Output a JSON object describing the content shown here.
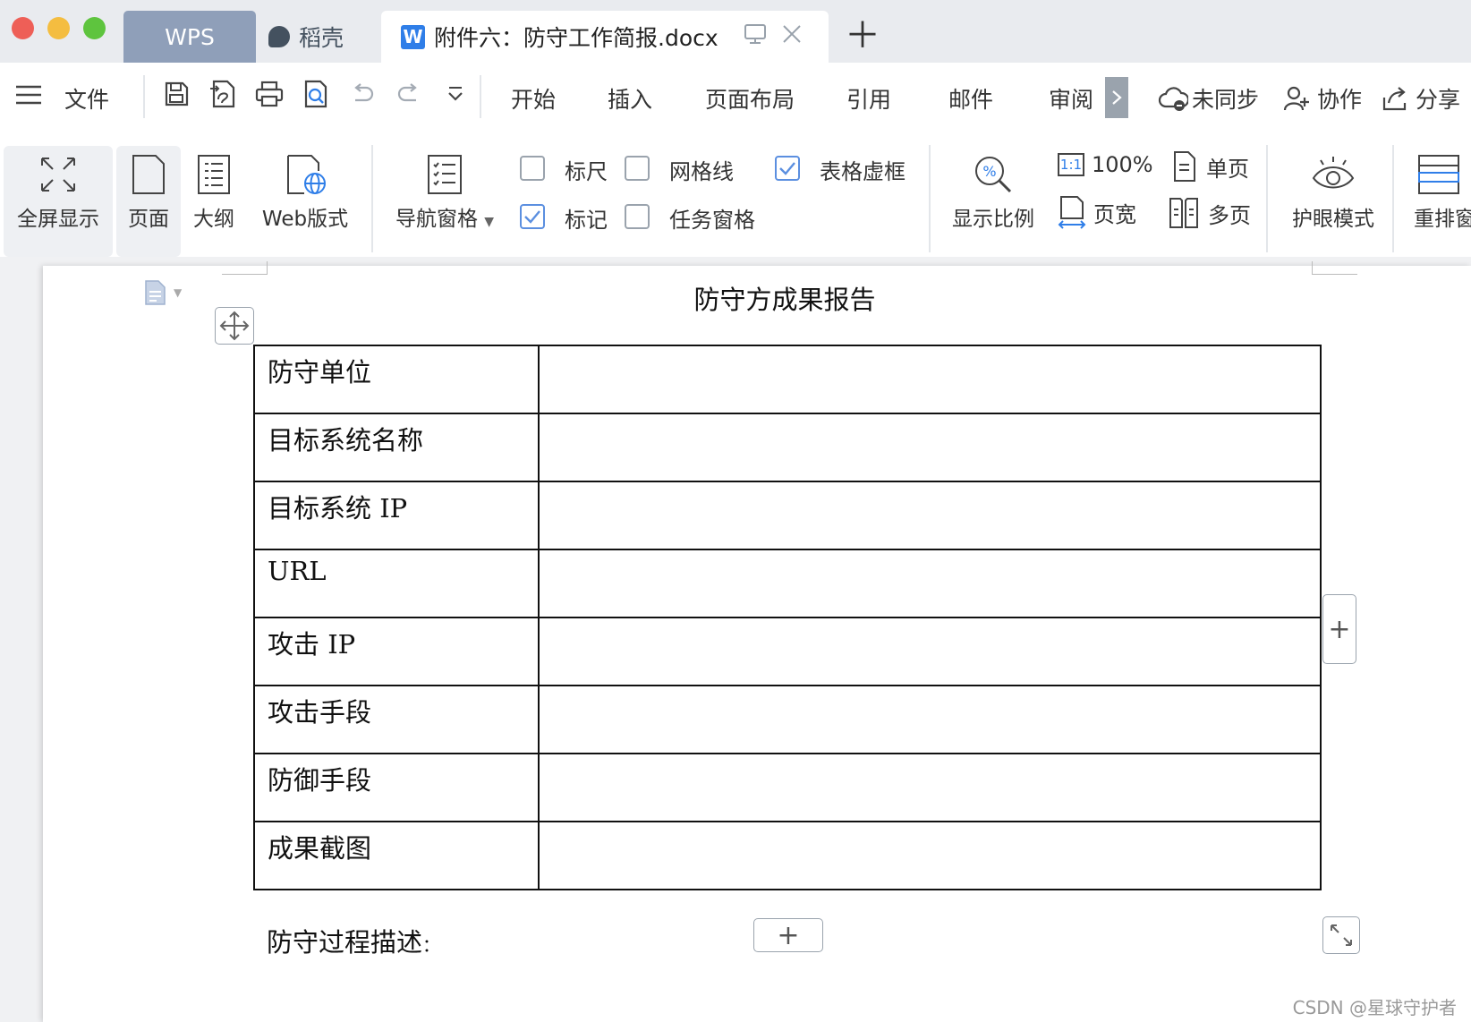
{
  "tabs": {
    "wps": "WPS",
    "daoke": "稻壳",
    "document": "附件六：防守工作简报.docx",
    "doc_badge": "W"
  },
  "menubar": {
    "file": "文件",
    "items": [
      "开始",
      "插入",
      "页面布局",
      "引用",
      "邮件",
      "审阅"
    ],
    "sync": "未同步",
    "collab": "协作",
    "share": "分享"
  },
  "ribbon": {
    "fullscreen": "全屏显示",
    "page": "页面",
    "outline": "大纲",
    "web": "Web版式",
    "nav_pane": "导航窗格",
    "ruler": "标尺",
    "gridlines": "网格线",
    "table_gridlines": "表格虚框",
    "marks": "标记",
    "task_pane": "任务窗格",
    "zoom": "显示比例",
    "zoom_100": "100%",
    "zoom_11": "1:1",
    "page_width": "页宽",
    "single_page": "单页",
    "multi_page": "多页",
    "eye_mode": "护眼模式",
    "rearrange": "重排窗",
    "checks": {
      "ruler": false,
      "gridlines": false,
      "table_gridlines": true,
      "marks": true,
      "task_pane": false
    }
  },
  "document": {
    "title": "防守方成果报告",
    "rows": [
      {
        "label": "防守单位",
        "value": ""
      },
      {
        "label": "目标系统名称",
        "value": ""
      },
      {
        "label": "目标系统 IP",
        "value": ""
      },
      {
        "label": "URL",
        "value": ""
      },
      {
        "label": "攻击 IP",
        "value": ""
      },
      {
        "label": "攻击手段",
        "value": ""
      },
      {
        "label": "防御手段",
        "value": ""
      },
      {
        "label": "成果截图",
        "value": ""
      }
    ],
    "process_label": "防守过程描述",
    "process_colon": "："
  },
  "watermark": "CSDN @星球守护者",
  "colors": {
    "accent": "#2f7ee8",
    "tab_wps": "#8f9fb9",
    "tabbar_bg": "#e9ebef"
  }
}
